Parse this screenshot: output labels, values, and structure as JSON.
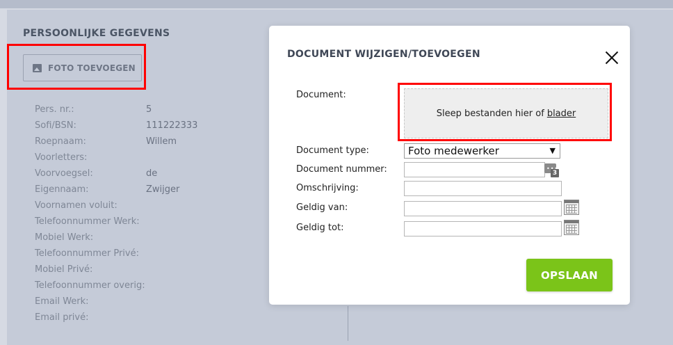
{
  "profile": {
    "section_title": "PERSOONLIJKE GEGEVENS",
    "photo_button_label": "FOTO TOEVOEGEN",
    "photo_button_icon": "image-icon",
    "fields": [
      {
        "label": "Pers. nr.:",
        "value": "5"
      },
      {
        "label": "Sofi/BSN:",
        "value": "111222333"
      },
      {
        "label": "Roepnaam:",
        "value": "Willem"
      },
      {
        "label": "Voorletters:",
        "value": ""
      },
      {
        "label": "Voorvoegsel:",
        "value": "de"
      },
      {
        "label": "Eigennaam:",
        "value": "Zwijger"
      },
      {
        "label": "Voornamen voluit:",
        "value": ""
      },
      {
        "label": "Telefoonnummer Werk:",
        "value": ""
      },
      {
        "label": "Mobiel Werk:",
        "value": ""
      },
      {
        "label": "Telefoonnummer Privé:",
        "value": ""
      },
      {
        "label": "Mobiel Privé:",
        "value": ""
      },
      {
        "label": "Telefoonnummer overig:",
        "value": ""
      },
      {
        "label": "Email Werk:",
        "value": ""
      },
      {
        "label": "Email privé:",
        "value": ""
      }
    ]
  },
  "modal": {
    "title": "DOCUMENT WIJZIGEN/TOEVOEGEN",
    "close_icon": "close-icon",
    "document_label": "Document:",
    "dropzone_text": "Sleep bestanden hier of",
    "dropzone_link": "blader",
    "document_type_label": "Document type:",
    "document_type_value": "Foto medewerker",
    "document_number_label": "Document nummer:",
    "document_number_value": "",
    "counter_badge": "3",
    "description_label": "Omschrijving:",
    "description_value": "",
    "valid_from_label": "Geldig van:",
    "valid_from_value": "",
    "valid_to_label": "Geldig tot:",
    "valid_to_value": "",
    "save_label": "OPSLAAN"
  },
  "colors": {
    "highlight": "#ff0000",
    "save_button": "#7bc419",
    "overlay": "#c5cbd8"
  }
}
